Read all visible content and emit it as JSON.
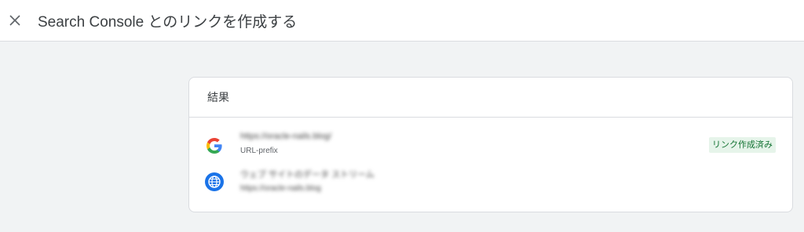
{
  "header": {
    "title": "Search Console とのリンクを作成する",
    "close_icon": "close-icon"
  },
  "card": {
    "heading": "結果",
    "property": {
      "url": "https://oracle-nails.blog/",
      "type": "URL-prefix",
      "status": "リンク作成済み",
      "icon": "google-g-icon"
    },
    "stream": {
      "name": "ウェブ サイトのデータ ストリーム",
      "url": "https://oracle-nails.blog",
      "icon": "globe-icon"
    }
  },
  "colors": {
    "badge_bg": "#e6f4ea",
    "badge_text": "#137333",
    "globe_blue": "#1a73e8"
  }
}
